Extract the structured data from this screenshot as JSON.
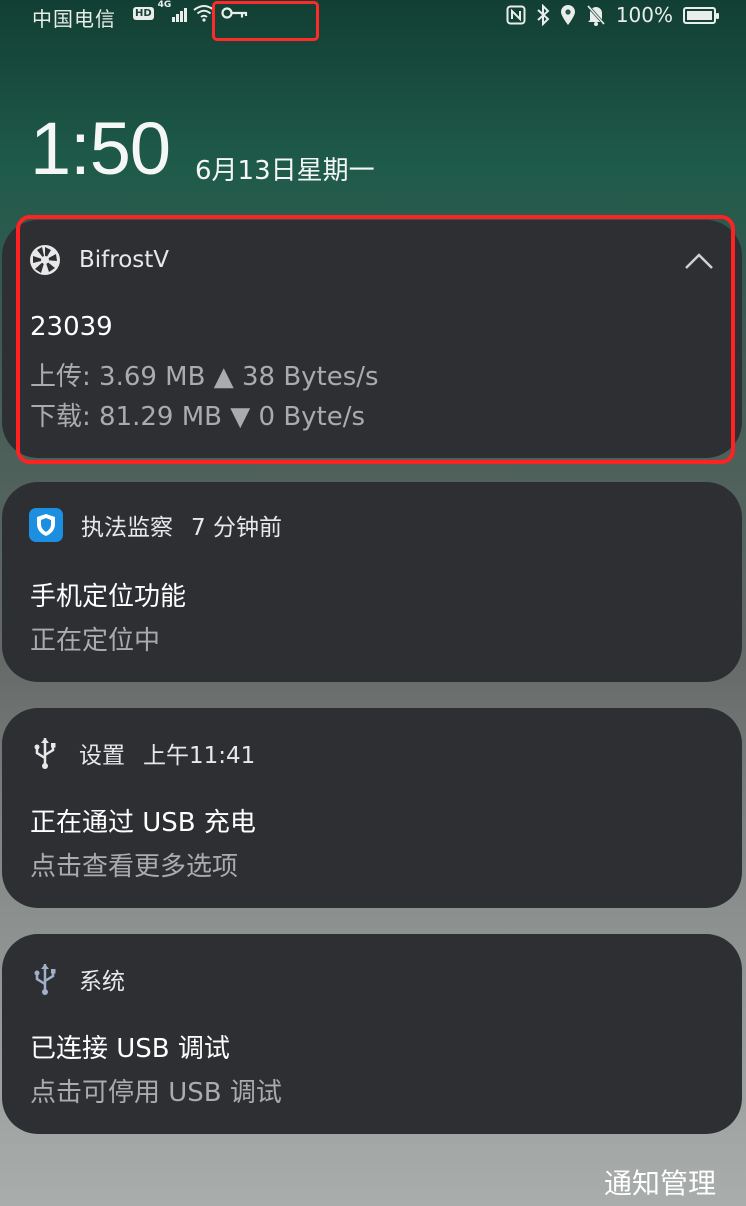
{
  "status_bar": {
    "carrier": "中国电信",
    "hd_badge": "HD",
    "network_type": "4G",
    "battery_percent": "100%",
    "icons": [
      "hd-icon",
      "signal-icon",
      "wifi-icon",
      "vpn-key-icon",
      "nfc-icon",
      "bluetooth-icon",
      "location-icon",
      "mute-bell-icon",
      "battery-charging-icon"
    ]
  },
  "lock_clock": {
    "time": "1:50",
    "date": "6月13日星期一"
  },
  "notifications": [
    {
      "app": "BifrostV",
      "icon": "aperture-icon",
      "expanded": true,
      "title": "23039",
      "upload": "上传:  3.69 MB ▲ 38 Bytes/s",
      "download": "下载:  81.29 MB ▼ 0 Byte/s"
    },
    {
      "app": "执法监察",
      "time": "7 分钟前",
      "icon": "shield-app-icon",
      "title": "手机定位功能",
      "subtitle": "正在定位中"
    },
    {
      "app": "设置",
      "time": "上午11:41",
      "icon": "usb-icon",
      "title": "正在通过 USB 充电",
      "subtitle": "点击查看更多选项"
    },
    {
      "app": "系统",
      "icon": "usb-icon",
      "title": "已连接 USB 调试",
      "subtitle": "点击可停用 USB 调试"
    }
  ],
  "footer": {
    "manage_label": "通知管理"
  },
  "colors": {
    "card_bg": "#2d2f33",
    "highlight": "#ff2222",
    "app_icon_blue": "#1d8fe0"
  }
}
